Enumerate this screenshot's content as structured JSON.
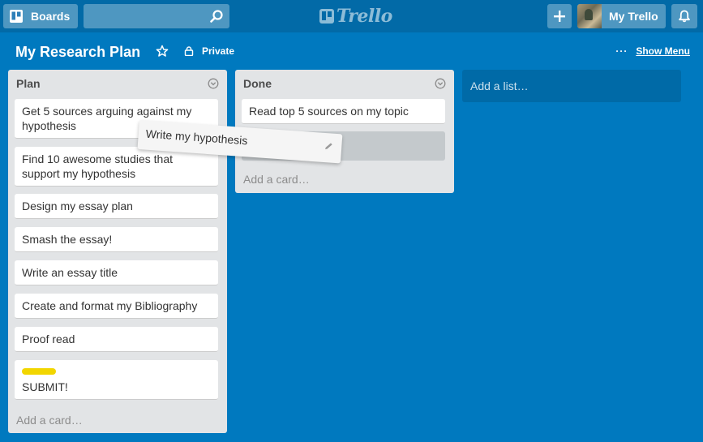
{
  "header": {
    "boards_label": "Boards",
    "search_placeholder": "",
    "logo_text": "Trello",
    "profile_label": "My Trello"
  },
  "board": {
    "title": "My Research Plan",
    "visibility": "Private",
    "show_menu_dots": "···",
    "show_menu_label": "Show Menu"
  },
  "lists": [
    {
      "title": "Plan",
      "cards": [
        "Get 5 sources arguing against my hypothesis",
        "Find 10 awesome studies that support my hypothesis",
        "Design my essay plan",
        "Smash the essay!",
        "Write an essay title",
        "Create and format my Bibliography",
        "Proof read",
        "SUBMIT!"
      ],
      "add_card": "Add a card…"
    },
    {
      "title": "Done",
      "cards": [
        "Read top 5 sources on my topic"
      ],
      "add_card": "Add a card…"
    }
  ],
  "add_list": "Add a list…",
  "dragging_card": "Write my hypothesis",
  "colors": {
    "board_bg": "#0079bf",
    "header_bg": "#026aa7",
    "list_bg": "#e2e4e6",
    "label_yellow": "#f2d600"
  },
  "icons": [
    "boards-icon",
    "search-icon",
    "trello-logo-icon",
    "plus-icon",
    "bell-icon",
    "star-icon",
    "lock-icon",
    "list-menu-icon",
    "pencil-icon"
  ]
}
